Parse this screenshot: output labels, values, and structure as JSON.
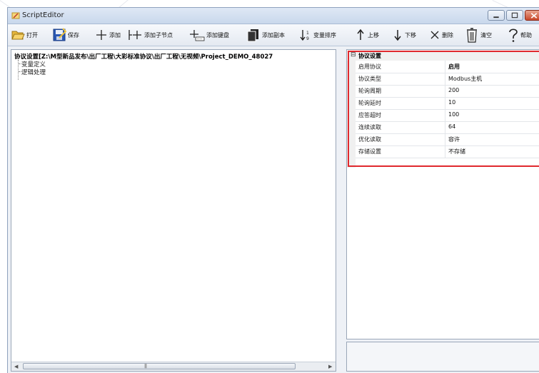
{
  "window": {
    "title": "ScriptEditor"
  },
  "toolbar": {
    "items": [
      {
        "id": "open",
        "label": "打开",
        "icon": "folder-open-icon"
      },
      {
        "id": "save",
        "label": "保存",
        "icon": "save-icon"
      },
      {
        "id": "add",
        "label": "添加",
        "icon": "plus-icon"
      },
      {
        "id": "add-child",
        "label": "添加子节点",
        "icon": "add-child-node-icon"
      },
      {
        "id": "add-keyboard",
        "label": "添加键盘",
        "icon": "add-keyboard-icon"
      },
      {
        "id": "add-copy",
        "label": "添加副本",
        "icon": "add-copy-icon"
      },
      {
        "id": "sort",
        "label": "变量排序",
        "icon": "sort-icon"
      },
      {
        "id": "move-up",
        "label": "上移",
        "icon": "arrow-up-icon"
      },
      {
        "id": "move-down",
        "label": "下移",
        "icon": "arrow-down-icon"
      },
      {
        "id": "delete",
        "label": "删除",
        "icon": "delete-x-icon"
      },
      {
        "id": "clear",
        "label": "清空",
        "icon": "trash-icon"
      },
      {
        "id": "help",
        "label": "帮助",
        "icon": "question-icon"
      }
    ]
  },
  "tree": {
    "root": "协议设置[Z:\\M型新品发布\\出厂工程\\大彩标准协议\\出厂工程\\无视频\\Project_DEMO_48027",
    "children": [
      "变量定义",
      "逻辑处理"
    ]
  },
  "properties": {
    "group": "协议设置",
    "rows": [
      {
        "key": "启用协议",
        "value": "启用"
      },
      {
        "key": "协议类型",
        "value": "Modbus主机"
      },
      {
        "key": "轮询周期",
        "value": "200"
      },
      {
        "key": "轮询延时",
        "value": "10"
      },
      {
        "key": "应答超时",
        "value": "100"
      },
      {
        "key": "连续读取",
        "value": "64"
      },
      {
        "key": "优化读取",
        "value": "容许"
      },
      {
        "key": "存储设置",
        "value": "不存储"
      }
    ]
  },
  "colors": {
    "highlight": "#e0292e",
    "titlebar": "#c9d8ec",
    "close_button": "#c8482b"
  }
}
